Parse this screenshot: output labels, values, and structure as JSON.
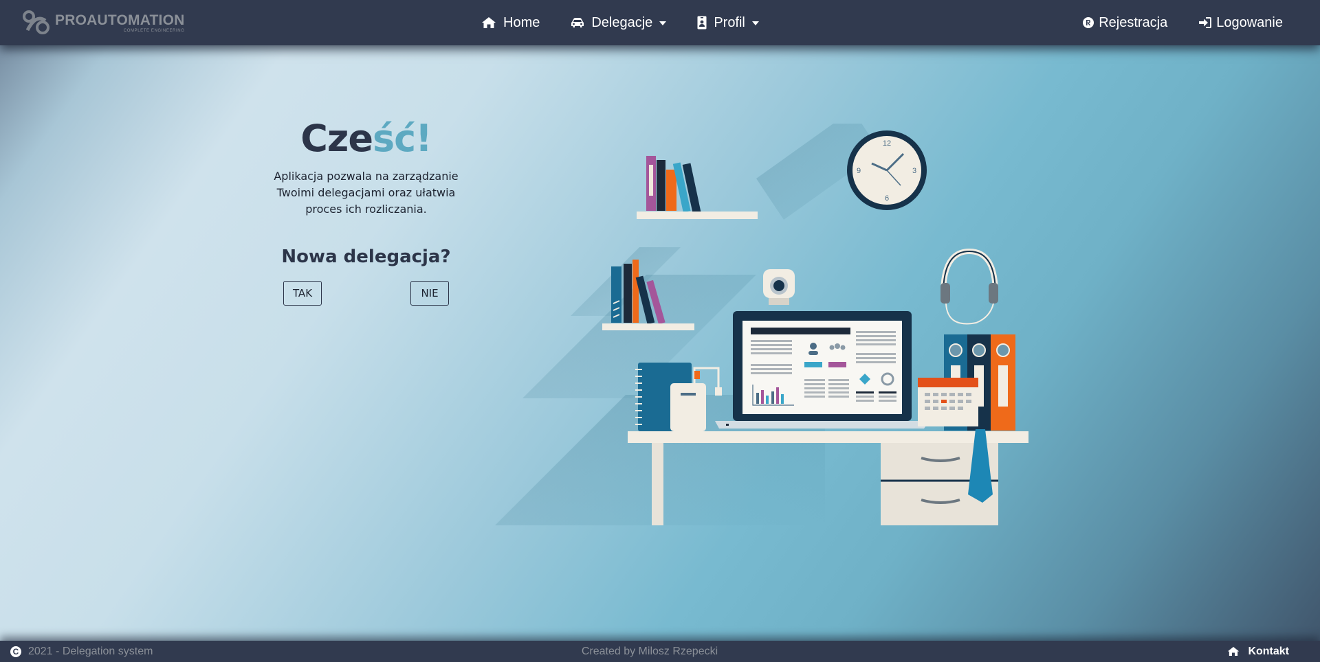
{
  "brand": {
    "name": "PROAUTOMATION",
    "tagline": "COMPLETE ENGINEERING"
  },
  "nav": {
    "home": "Home",
    "delegations": "Delegacje",
    "profile": "Profil",
    "register": "Rejestracja",
    "login": "Logowanie"
  },
  "hero": {
    "greeting_dark": "Cze",
    "greeting_light": "ść!",
    "intro": "Aplikacja pozwala na zarządzanie Twoimi delegacjami oraz ułatwia proces ich rozliczania.",
    "question": "Nowa delegacja?",
    "yes_label": "TAK",
    "no_label": "NIE"
  },
  "clock": {
    "n12": "12",
    "n3": "3",
    "n6": "6",
    "n9": "9"
  },
  "footer": {
    "copyright_icon": "C",
    "copyright_text": "2021 - Delegation system",
    "credit": "Created by Milosz Rzepecki",
    "contact": "Kontakt"
  },
  "colors": {
    "navbar": "#313a4f",
    "accent": "#5da9c1",
    "heading": "#2c3549",
    "muted_text": "#8b9098"
  },
  "icons": [
    "logo-icon",
    "home-icon",
    "car-icon",
    "id-badge-icon",
    "registered-icon",
    "sign-in-icon",
    "copyright-icon",
    "home-icon"
  ]
}
